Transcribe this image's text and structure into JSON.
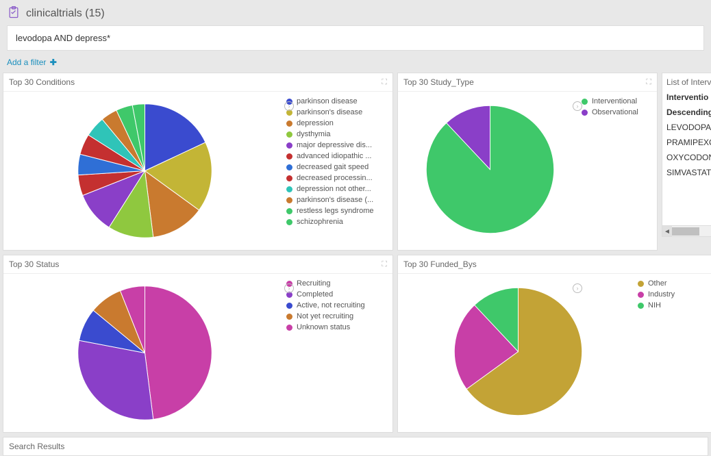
{
  "header": {
    "title": "clinicaltrials (15)"
  },
  "search": {
    "query": "levodopa AND depress*"
  },
  "filter": {
    "label": "Add a filter"
  },
  "panels": {
    "conditions": {
      "title": "Top 30 Conditions"
    },
    "studyType": {
      "title": "Top 30 Study_Type"
    },
    "status": {
      "title": "Top 30 Status"
    },
    "fundedBy": {
      "title": "Top 30 Funded_Bys"
    },
    "interventions": {
      "title": "List of Interv",
      "heading1": "Interventio",
      "heading2": "Descending",
      "items": [
        "LEVODOPA",
        "PRAMIPEXOL",
        "OXYCODONE",
        "SIMVASTATIN"
      ]
    }
  },
  "resultsBar": {
    "label": "Search Results"
  },
  "chart_data": [
    {
      "type": "pie",
      "title": "Top 30 Conditions",
      "series": [
        {
          "name": "parkinson disease",
          "value": 18,
          "color": "#3a4bcf"
        },
        {
          "name": "parkinson's disease",
          "value": 17,
          "color": "#c3b536"
        },
        {
          "name": "depression",
          "value": 13,
          "color": "#c97a2f"
        },
        {
          "name": "dysthymia",
          "value": 11,
          "color": "#8fc83f"
        },
        {
          "name": "major depressive dis...",
          "value": 10,
          "color": "#8a3fc8"
        },
        {
          "name": "advanced idiopathic ...",
          "value": 5,
          "color": "#c43030"
        },
        {
          "name": "decreased gait speed",
          "value": 5,
          "color": "#2f6fd6"
        },
        {
          "name": "decreased processin...",
          "value": 5,
          "color": "#c43030"
        },
        {
          "name": "depression not other...",
          "value": 5,
          "color": "#2fc4b8"
        },
        {
          "name": "parkinson's disease (...",
          "value": 4,
          "color": "#c97a2f"
        },
        {
          "name": "restless legs syndrome",
          "value": 4,
          "color": "#3fc86a"
        },
        {
          "name": "schizophrenia",
          "value": 3,
          "color": "#3fc86a"
        }
      ]
    },
    {
      "type": "pie",
      "title": "Top 30 Study_Type",
      "series": [
        {
          "name": "Interventional",
          "value": 88,
          "color": "#3fc86a"
        },
        {
          "name": "Observational",
          "value": 12,
          "color": "#8a3fc8"
        }
      ]
    },
    {
      "type": "pie",
      "title": "Top 30 Status",
      "series": [
        {
          "name": "Recruiting",
          "value": 48,
          "color": "#c83fa7"
        },
        {
          "name": "Completed",
          "value": 30,
          "color": "#8a3fc8"
        },
        {
          "name": "Active, not recruiting",
          "value": 8,
          "color": "#3a4bcf"
        },
        {
          "name": "Not yet recruiting",
          "value": 8,
          "color": "#c97a2f"
        },
        {
          "name": "Unknown status",
          "value": 6,
          "color": "#c83fa7"
        }
      ]
    },
    {
      "type": "pie",
      "title": "Top 30 Funded_Bys",
      "series": [
        {
          "name": "Other",
          "value": 65,
          "color": "#c3a336"
        },
        {
          "name": "Industry",
          "value": 23,
          "color": "#c83fa7"
        },
        {
          "name": "NIH",
          "value": 12,
          "color": "#3fc86a"
        }
      ]
    }
  ]
}
